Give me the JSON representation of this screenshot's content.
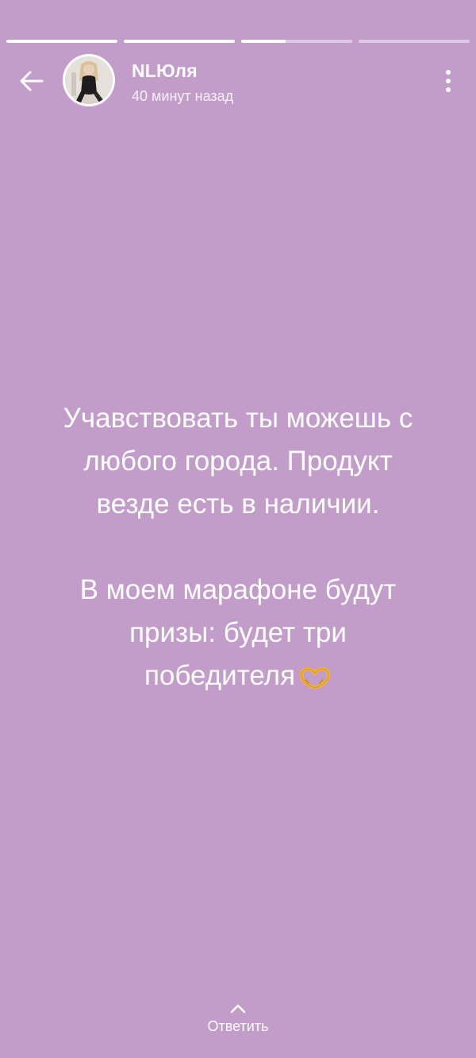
{
  "story": {
    "progress_segments": [
      1.0,
      1.0,
      0.4,
      0.0
    ],
    "background_color": "#c39dca"
  },
  "header": {
    "back_icon": "arrow-left-icon",
    "user_name": "NLЮля",
    "timestamp": "40 минут назад",
    "menu_icon": "more-vertical-icon"
  },
  "content": {
    "paragraph1_line1": "Учавствовать ты можешь с",
    "paragraph1_line2": "любого города. Продукт",
    "paragraph1_line3": "везде есть в наличии.",
    "paragraph2_line1": "В моем марафоне будут",
    "paragraph2_line2": "призы: будет три",
    "paragraph2_line3": "победителя",
    "emoji": "heart-hands-emoji"
  },
  "footer": {
    "reply_icon": "chevron-up-icon",
    "reply_label": "Ответить"
  }
}
